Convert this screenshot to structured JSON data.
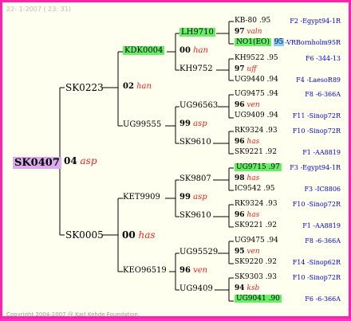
{
  "header": {
    "timestamp": "22- 1-2007 ( 23: 31)"
  },
  "footer": {
    "copyright": "Copyright 2004-2007 @ Karl Kehde Foundation."
  },
  "subject": {
    "name": "SK0407",
    "year": "04",
    "mark": "asp"
  },
  "gen1": {
    "sire": {
      "name": "SK0223"
    },
    "dam": {
      "name": "SK0005",
      "year": "00",
      "mark": "has"
    }
  },
  "gen2": {
    "ss": {
      "name": "KDK0004",
      "year": "02",
      "mark": "han"
    },
    "sd": {
      "name": "UG99555"
    },
    "ds": {
      "name": "KET9909",
      "year": "99",
      "mark": "asp"
    },
    "dd": {
      "name": "KEO96519",
      "year": "96",
      "mark": "ven"
    }
  },
  "gen3": {
    "sss": {
      "name": "LH9710"
    },
    "ssd": {
      "name": "KH9752",
      "year": "00",
      "mark": "han"
    },
    "sds": {
      "name": "UG96563"
    },
    "sdd": {
      "name": "SK9610",
      "year": "99",
      "mark": "asp"
    },
    "dss": {
      "name": "SK9807"
    },
    "dsd": {
      "name": "SK9610",
      "year": "99",
      "mark": "asp"
    },
    "dds": {
      "name": "UG95529"
    },
    "ddd": {
      "name": "UG9409",
      "year": "96",
      "mark": "ven"
    }
  },
  "gen4": [
    {
      "top": "KB-80 .95",
      "mid_y": "97",
      "mid_m": "valn",
      "bot_a": "NO1(EO)",
      "bot_b": "95",
      "r1": "F2 -Egypt94-1R",
      "r2": "-VRBornholm95R"
    },
    {
      "top": "KH9522 .95",
      "mid_y": "97",
      "mid_m": "uff",
      "bot": "UG9440 .94",
      "r1": "F6 -344-13",
      "r2": "F4 -LaesoR89"
    },
    {
      "top": "UG9475 .94",
      "mid_y": "96",
      "mid_m": "ven",
      "bot": "UG9409 .94",
      "r1": "F8 -6-366A",
      "r2": "F11 -Sinop72R"
    },
    {
      "top": "RK9324 .93",
      "mid_y": "96",
      "mid_m": "has",
      "bot": "SK9221 .92",
      "r1": "F10 -Sinop72R",
      "r2": "F1 -AA8819"
    },
    {
      "top": "UG9715 .97",
      "mid_y": "98",
      "mid_m": "has",
      "bot": "IC9542 .95",
      "r1": "F3 -Egypt94-1R",
      "r2": "F3 -IC8806"
    },
    {
      "top": "RK9324 .93",
      "mid_y": "96",
      "mid_m": "has",
      "bot": "SK9221 .92",
      "r1": "F10 -Sinop72R",
      "r2": "F1 -AA8819"
    },
    {
      "top": "UG9475 .94",
      "mid_y": "95",
      "mid_m": "ven",
      "bot": "SK9220 .92",
      "r1": "F8 -6-366A",
      "r2": "F14 -Sinop62R"
    },
    {
      "top": "SK9303 .93",
      "mid_y": "94",
      "mid_m": "ksb",
      "bot": "UG9041 .90",
      "r1": "F10 -Sinop72R",
      "r2": "F6 -6-366A"
    }
  ]
}
